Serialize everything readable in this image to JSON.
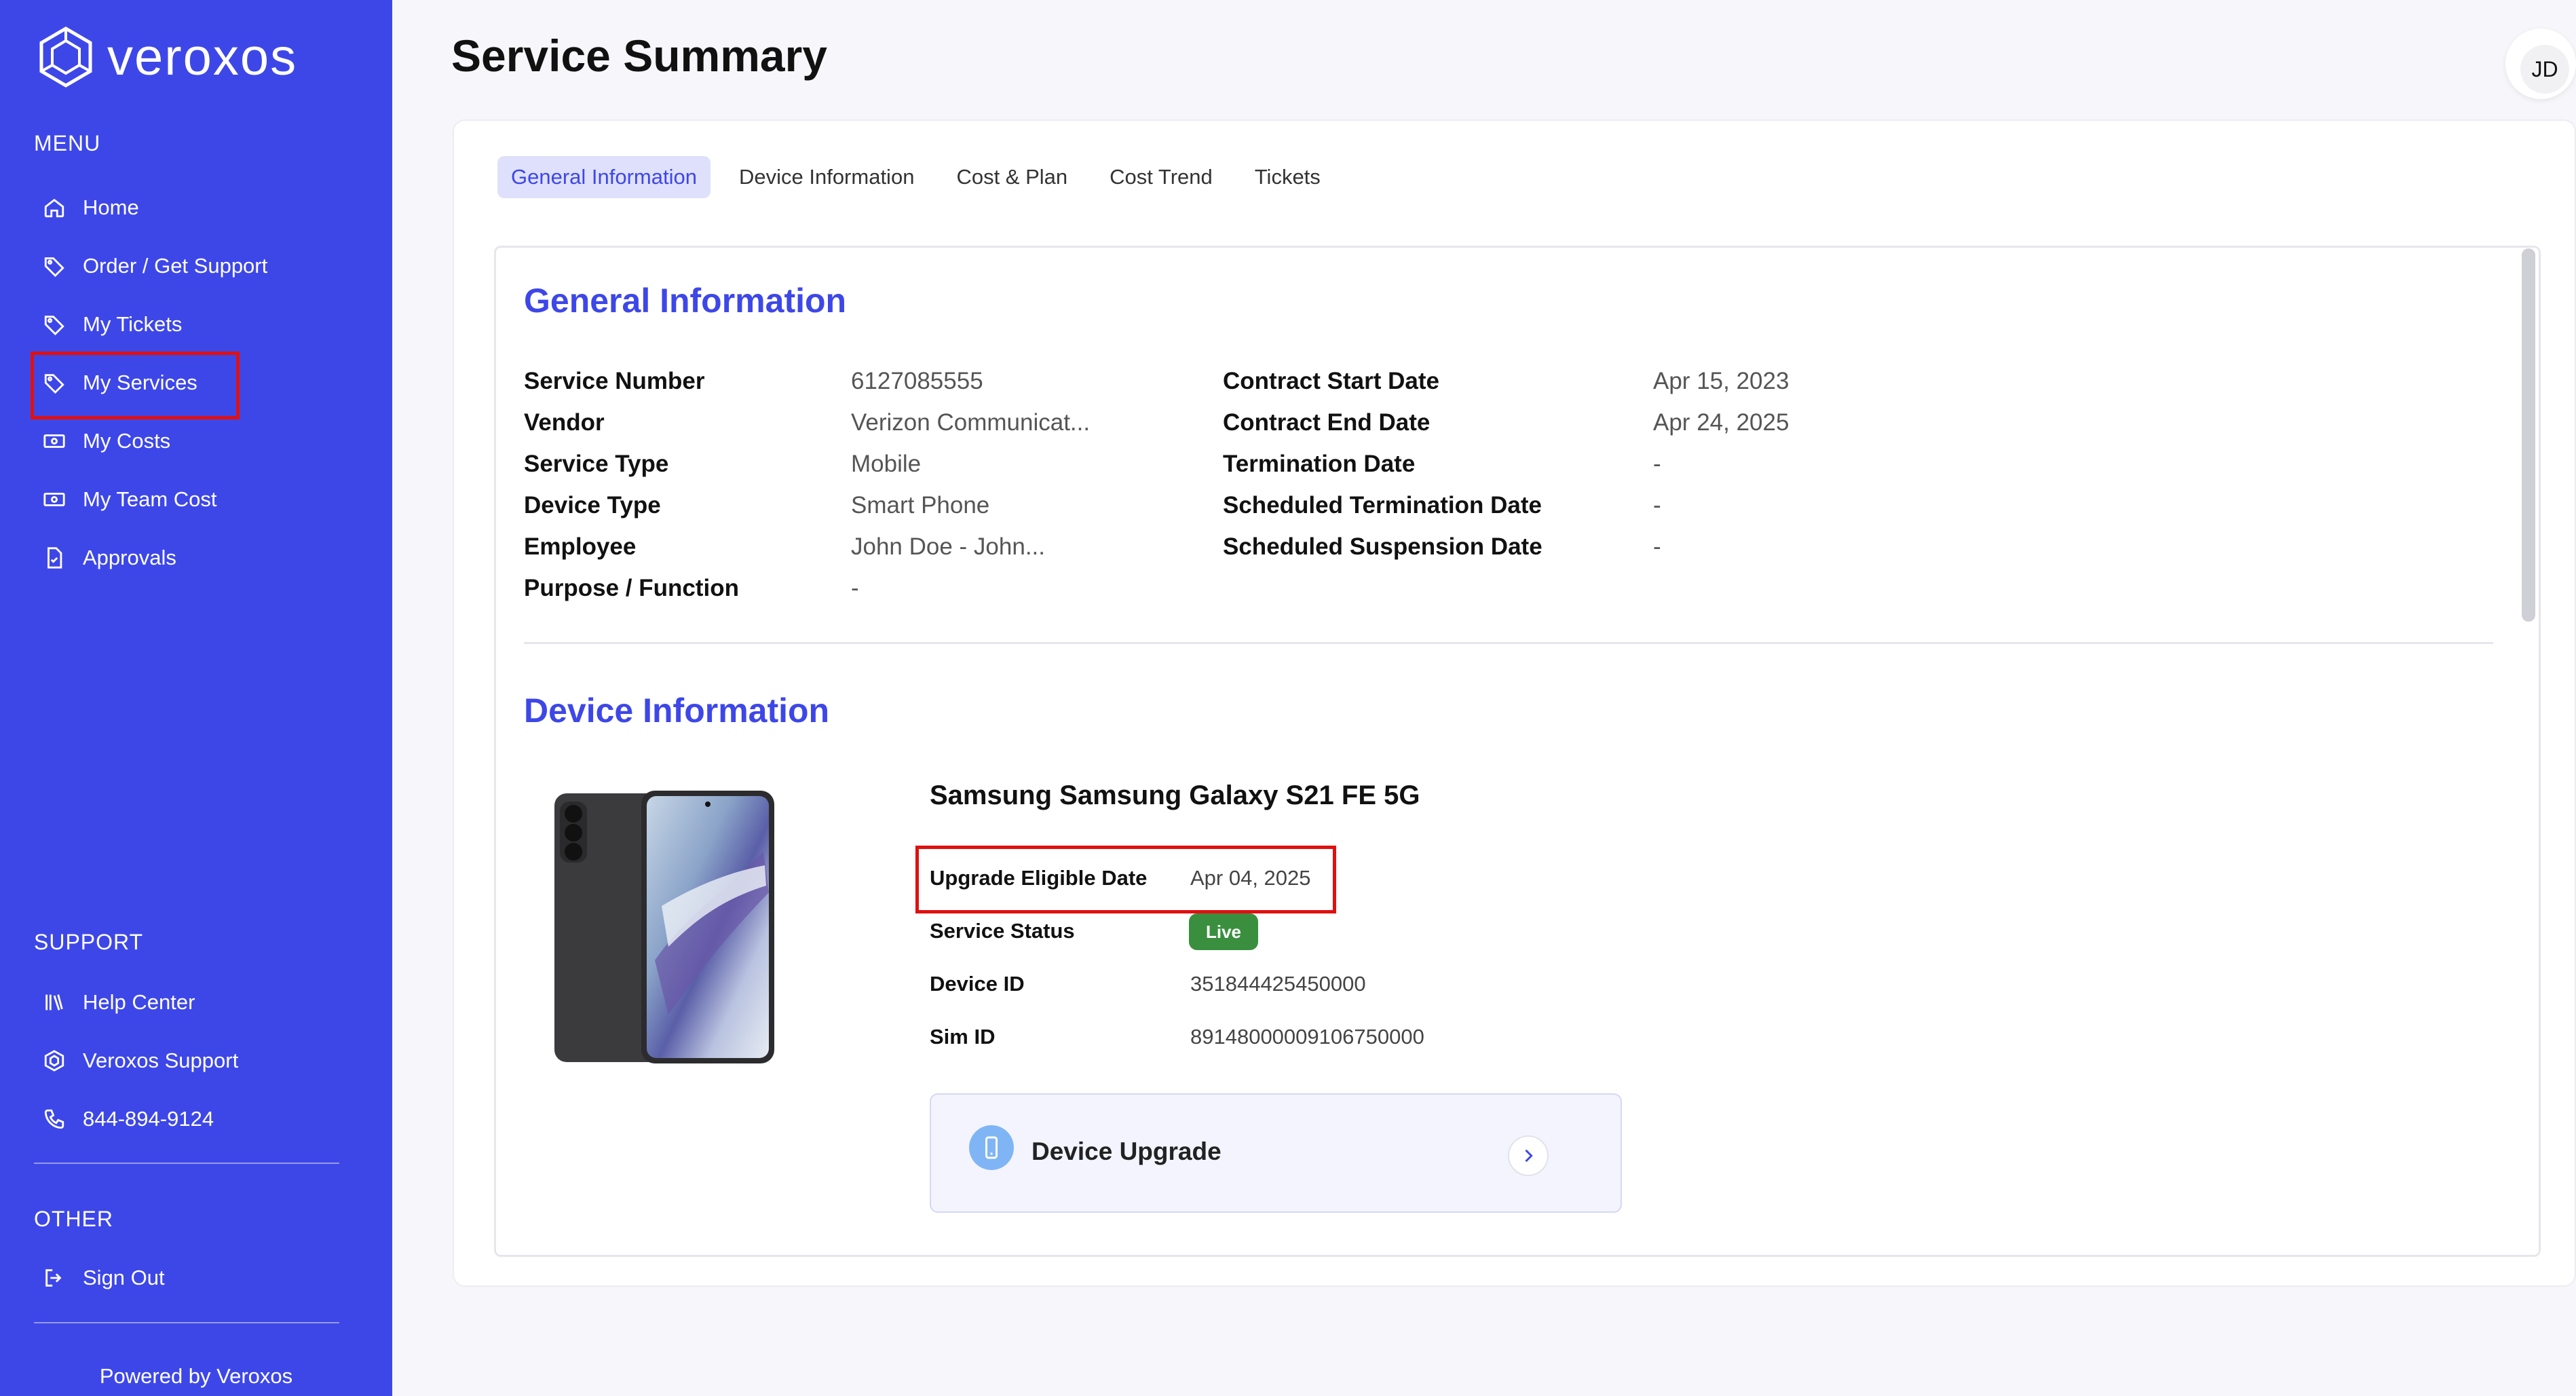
{
  "brand": {
    "name": "veroxos"
  },
  "sidebar": {
    "menu_title": "MENU",
    "menu": [
      {
        "label": "Home",
        "icon": "home-icon"
      },
      {
        "label": "Order / Get Support",
        "icon": "tag-icon"
      },
      {
        "label": "My Tickets",
        "icon": "tag-icon"
      },
      {
        "label": "My Services",
        "icon": "tag-icon"
      },
      {
        "label": "My Costs",
        "icon": "money-icon"
      },
      {
        "label": "My Team Cost",
        "icon": "money-icon"
      },
      {
        "label": "Approvals",
        "icon": "document-icon"
      }
    ],
    "support_title": "SUPPORT",
    "support": [
      {
        "label": "Help Center",
        "icon": "library-icon"
      },
      {
        "label": "Veroxos Support",
        "icon": "hexagon-icon"
      },
      {
        "label": "844-894-9124",
        "icon": "phone-icon"
      }
    ],
    "other_title": "OTHER",
    "other": [
      {
        "label": "Sign Out",
        "icon": "sign-out-icon"
      }
    ],
    "footer": "Powered by Veroxos"
  },
  "header": {
    "title": "Service Summary",
    "avatar_initials": "JD"
  },
  "tabs": [
    {
      "label": "General Information",
      "active": true
    },
    {
      "label": "Device Information",
      "active": false
    },
    {
      "label": "Cost & Plan",
      "active": false
    },
    {
      "label": "Cost Trend",
      "active": false
    },
    {
      "label": "Tickets",
      "active": false
    }
  ],
  "general": {
    "title": "General Information",
    "left": [
      {
        "label": "Service Number",
        "value": "6127085555"
      },
      {
        "label": "Vendor",
        "value": "Verizon Communicat..."
      },
      {
        "label": "Service Type",
        "value": "Mobile"
      },
      {
        "label": "Device Type",
        "value": "Smart Phone"
      },
      {
        "label": "Employee",
        "value": "John Doe - John..."
      },
      {
        "label": "Purpose / Function",
        "value": "-"
      }
    ],
    "right": [
      {
        "label": "Contract Start Date",
        "value": "Apr 15, 2023"
      },
      {
        "label": "Contract End Date",
        "value": "Apr 24, 2025"
      },
      {
        "label": "Termination Date",
        "value": "-"
      },
      {
        "label": "Scheduled Termination Date",
        "value": "-"
      },
      {
        "label": "Scheduled Suspension Date",
        "value": "-"
      }
    ]
  },
  "device": {
    "title": "Device Information",
    "name": "Samsung Samsung Galaxy S21 FE 5G",
    "fields": [
      {
        "label": "Upgrade Eligible Date",
        "value": "Apr 04, 2025"
      },
      {
        "label": "Service Status",
        "value": ""
      },
      {
        "label": "Device ID",
        "value": "351844425450000"
      },
      {
        "label": "Sim ID",
        "value": "89148000009106750000"
      }
    ],
    "status_badge": "Live",
    "upgrade_label": "Device Upgrade"
  },
  "colors": {
    "accent": "#3d47e8",
    "highlight": "#e01010",
    "live": "#3a8f3f"
  }
}
